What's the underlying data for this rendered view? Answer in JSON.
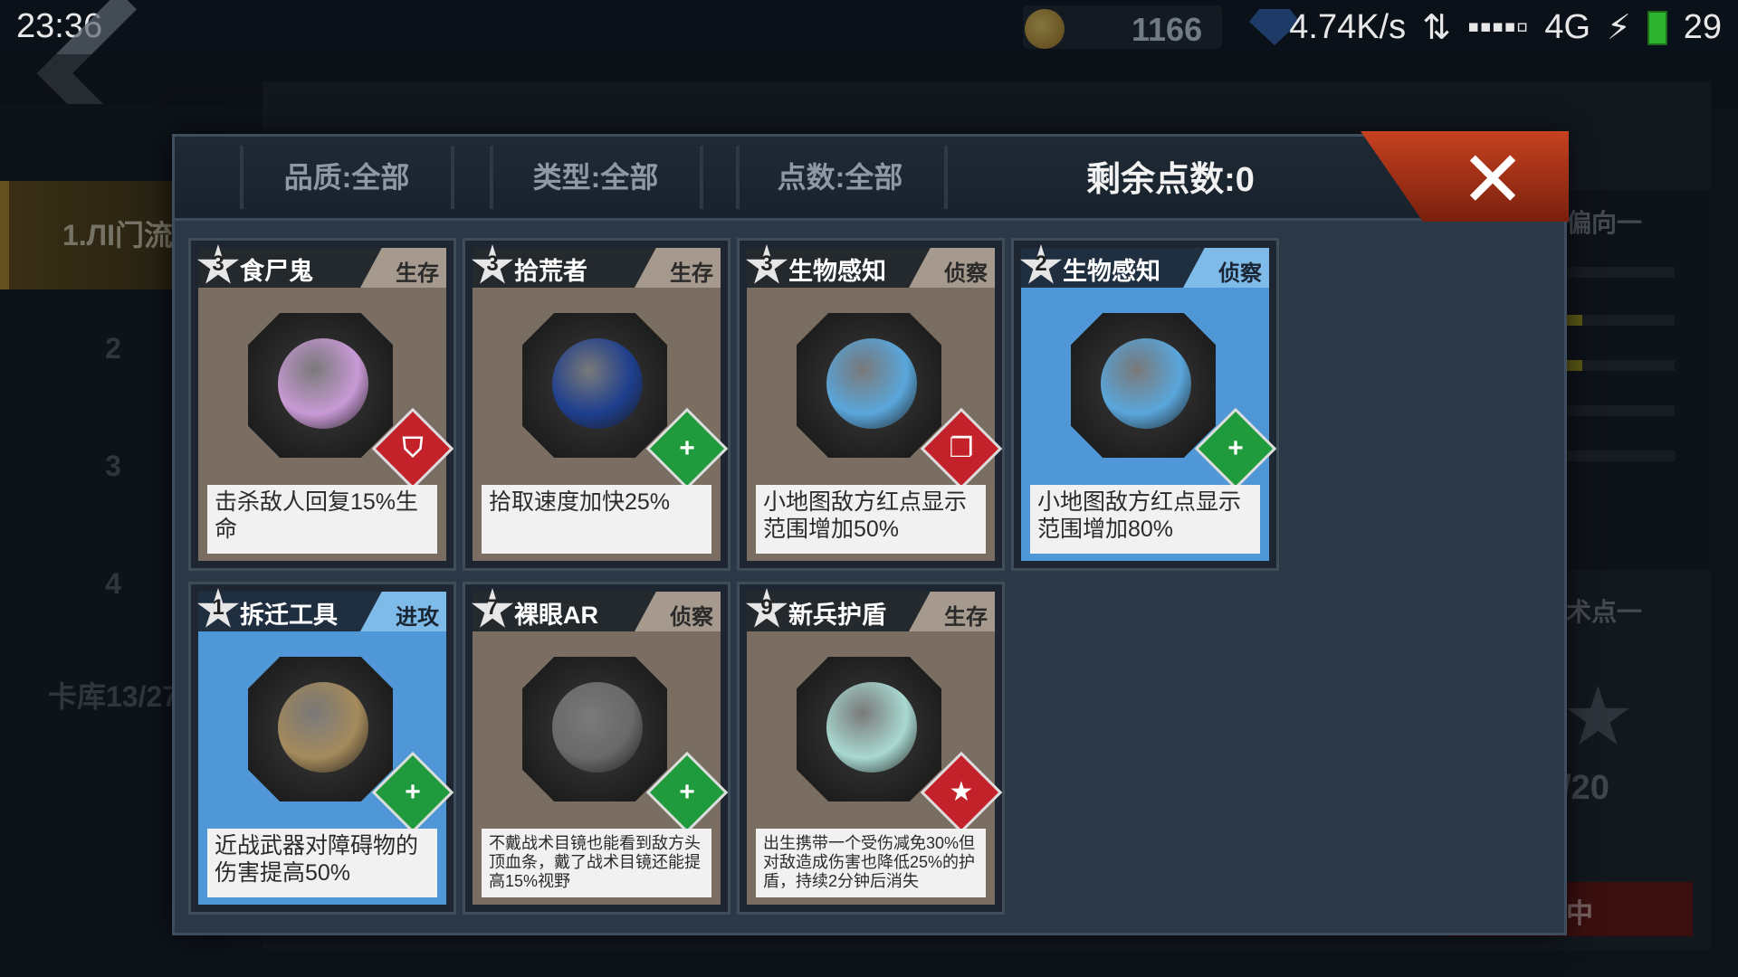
{
  "status_bar": {
    "time": "23:36",
    "net_speed": "4.74K/s",
    "signal": "▪▪▪▪▫",
    "network": "4G",
    "battery": "29"
  },
  "currency": {
    "gold": "1166"
  },
  "background": {
    "sidebar": [
      "1.ЛІ门流",
      "2",
      "3",
      "4",
      "卡库13/27"
    ],
    "right_labels": [
      "偏向一",
      "术点一"
    ],
    "count": "/20",
    "button": "中"
  },
  "filters": {
    "quality": "品质:全部",
    "type": "类型:全部",
    "points": "点数:全部"
  },
  "remaining_points": "剩余点数:0",
  "cards": [
    {
      "cost": "3",
      "name": "食尸鬼",
      "type": "生存",
      "desc": "击杀敌人回复15%生命",
      "variant": "brown",
      "badge": "red",
      "badge_icon": "shield-icon",
      "art_color": "#c99ad6"
    },
    {
      "cost": "3",
      "name": "拾荒者",
      "type": "生存",
      "desc": "拾取速度加快25%",
      "variant": "brown",
      "badge": "green",
      "badge_icon": "plus-icon",
      "art_color": "#1e3f8e"
    },
    {
      "cost": "3",
      "name": "生物感知",
      "type": "侦察",
      "desc": "小地图敌方红点显示范围增加50%",
      "variant": "brown",
      "badge": "red",
      "badge_icon": "cards-icon",
      "art_color": "#5aa7dc"
    },
    {
      "cost": "2",
      "name": "生物感知",
      "type": "侦察",
      "desc": "小地图敌方红点显示范围增加80%",
      "variant": "blue",
      "badge": "green",
      "badge_icon": "plus-icon",
      "art_color": "#5aa7dc"
    },
    {
      "cost": "1",
      "name": "拆迁工具",
      "type": "进攻",
      "desc": "近战武器对障碍物的伤害提高50%",
      "variant": "blue",
      "badge": "green",
      "badge_icon": "plus-icon",
      "art_color": "#a58a5c"
    },
    {
      "cost": "7",
      "name": "裸眼AR",
      "type": "侦察",
      "desc": "不戴战术目镜也能看到敌方头顶血条，戴了战术目镜还能提高15%视野",
      "variant": "brown",
      "badge": "green",
      "badge_icon": "plus-icon",
      "art_color": "#6a6a6a"
    },
    {
      "cost": "9",
      "name": "新兵护盾",
      "type": "生存",
      "desc": "出生携带一个受伤减免30%但对敌造成伤害也降低25%的护盾，持续2分钟后消失",
      "variant": "brown",
      "badge": "red",
      "badge_icon": "star-icon",
      "art_color": "#a9d9d1"
    }
  ]
}
